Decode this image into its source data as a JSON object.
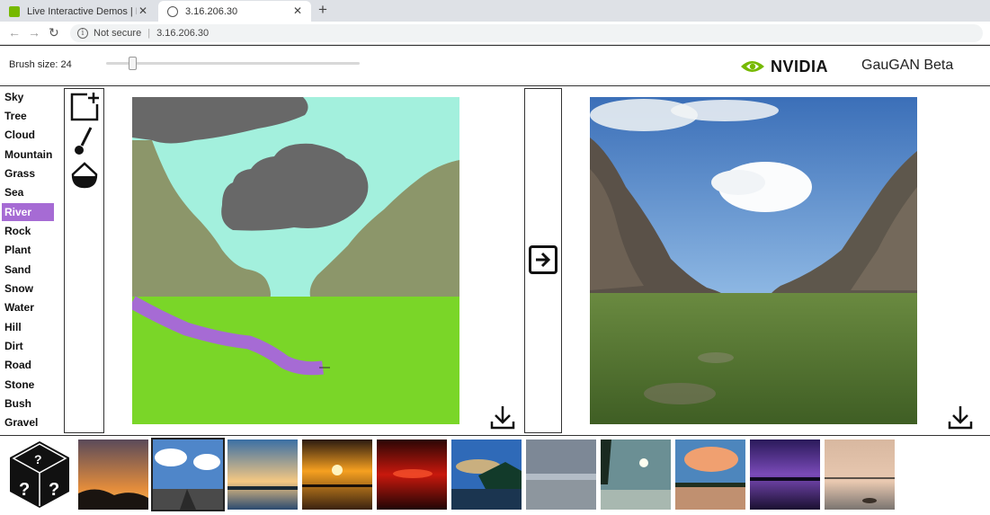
{
  "browser": {
    "tabs": [
      {
        "title": "Live Interactive Demos | NVIDIA",
        "active": false
      },
      {
        "title": "3.16.206.30",
        "active": true
      }
    ],
    "new_tab": "+",
    "security_text": "Not secure",
    "url": "3.16.206.30"
  },
  "toolbar": {
    "brush_label": "Brush size: 24",
    "brush_size": 24,
    "brand": "NVIDIA",
    "app_title": "GauGAN Beta"
  },
  "labels": {
    "selected": "River",
    "selected_color": "#a66bd4",
    "items": [
      "Sky",
      "Tree",
      "Cloud",
      "Mountain",
      "Grass",
      "Sea",
      "River",
      "Rock",
      "Plant",
      "Sand",
      "Snow",
      "Water",
      "Hill",
      "Dirt",
      "Road",
      "Stone",
      "Bush",
      "Gravel"
    ]
  },
  "tools": [
    "new-canvas-icon",
    "brush-icon",
    "paint-bucket-icon"
  ],
  "segmentation_colors": {
    "sky": "#a3f0dd",
    "cloud": "#686868",
    "mountain": "#8c966a",
    "grass": "#7ad628",
    "river": "#a66bd4"
  },
  "icons": {
    "convert": "arrow-right-icon",
    "download": "download-icon",
    "random": "dice-icon"
  },
  "thumbnails_count": 11
}
